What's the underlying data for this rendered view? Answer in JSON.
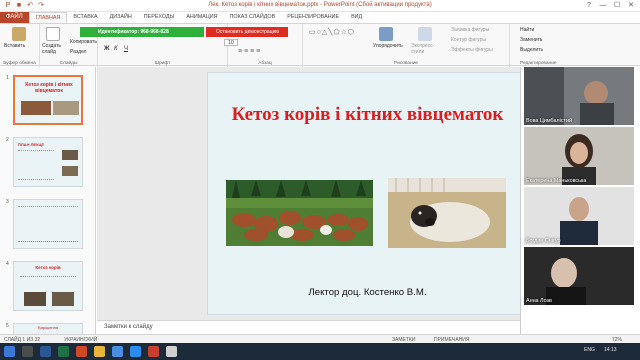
{
  "window": {
    "title": "Лек. Кетоз корів і кітних вівцематок.pptx - PowerPoint (Сбой активации продукта)",
    "controls": [
      "?",
      "—",
      "☐",
      "✕"
    ]
  },
  "tabs": {
    "file": "ФАЙЛ",
    "items": [
      "ГЛАВНАЯ",
      "ВСТАВКА",
      "ДИЗАЙН",
      "ПЕРЕХОДЫ",
      "АНИМАЦИЯ",
      "ПОКАЗ СЛАЙДОВ",
      "РЕЦЕНЗИРОВАНИЕ",
      "ВИД"
    ]
  },
  "ribbon": {
    "paste": "Вставить",
    "clipboard_group": "Буфер обмена",
    "create_slide": "Создать слайд",
    "copy": "Копировать",
    "section": "Раздел",
    "slides_group": "Слайды",
    "font_group": "Шрифт",
    "paragraph_group": "Абзац",
    "drawing_group": "Рисование",
    "arrange": "Упорядочить",
    "express_styles": "Экспресс-стили",
    "shape_fill": "Заливка фигуры",
    "shape_outline": "Контур фигуры",
    "shape_effects": "Эффекты фигуры",
    "find": "Найти",
    "replace": "Заменить",
    "select": "Выделить",
    "editing_group": "Редактирование",
    "font_size": "10",
    "demo_id": "Идентификатор: 968-968-828",
    "stop_demo": "Остановить демонстрацию"
  },
  "thumbnails": [
    {
      "num": "1",
      "title": "Кетоз корів і кітних вівцематок"
    },
    {
      "num": "2",
      "title": "ПЛАН ЛЕКЦІЇ"
    },
    {
      "num": "3",
      "title": ""
    },
    {
      "num": "4",
      "title": "Кетоз корів"
    },
    {
      "num": "5",
      "title": "Вирішення"
    }
  ],
  "slide": {
    "title": "Кетоз корів і кітних вівцематок",
    "lector": "Лектор доц. Костенко В.М."
  },
  "notes_placeholder": "Заметки к слайду",
  "participants": [
    {
      "name": "Вова Цимбалістий"
    },
    {
      "name": "Екатерина Маньковська"
    },
    {
      "name": "Богдан Снігур"
    },
    {
      "name": "Анна Лозв"
    }
  ],
  "status": {
    "slide_counter": "СЛАЙД 1 ИЗ 32",
    "language": "УКРАИНСКИЙ",
    "notes": "ЗАМЕТКИ",
    "comments": "ПРИМЕЧАНИЯ",
    "zoom": "72%"
  },
  "taskbar": {
    "lang": "ENG",
    "time": "14:13"
  },
  "colors": {
    "accent": "#b7472a",
    "title_red": "#d61f1f",
    "demo_green": "#2fb03a",
    "stop_red": "#e02b20"
  }
}
